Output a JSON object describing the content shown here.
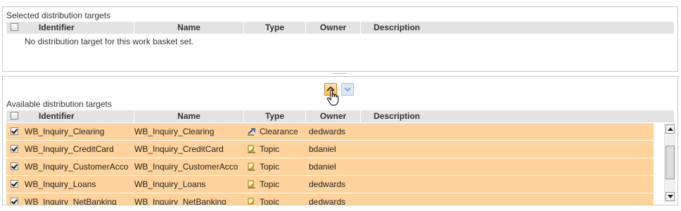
{
  "selected": {
    "title": "Selected distribution targets",
    "columns": {
      "identifier": "Identifier",
      "name": "Name",
      "type": "Type",
      "owner": "Owner",
      "description": "Description"
    },
    "empty_message": "No distribution target for this work basket set."
  },
  "available": {
    "title": "Available distribution targets",
    "columns": {
      "identifier": "Identifier",
      "name": "Name",
      "type": "Type",
      "owner": "Owner",
      "description": "Description"
    },
    "rows": [
      {
        "identifier": "WB_Inquiry_Clearing",
        "name": "WB_Inquiry_Clearing",
        "type": "Clearance",
        "type_icon": "clearance-arrow-icon",
        "owner": "dedwards",
        "description": "",
        "checked": true
      },
      {
        "identifier": "WB_Inquiry_CreditCard",
        "name": "WB_Inquiry_CreditCard",
        "type": "Topic",
        "type_icon": "topic-icon",
        "owner": "bdaniel",
        "description": "",
        "checked": true
      },
      {
        "identifier": "WB_Inquiry_CustomerAcco",
        "name": "WB_Inquiry_CustomerAcco",
        "type": "Topic",
        "type_icon": "topic-icon",
        "owner": "bdaniel",
        "description": "",
        "checked": true
      },
      {
        "identifier": "WB_Inquiry_Loans",
        "name": "WB_Inquiry_Loans",
        "type": "Topic",
        "type_icon": "topic-icon",
        "owner": "dedwards",
        "description": "",
        "checked": true
      },
      {
        "identifier": "WB_Inquiry_NetBanking",
        "name": "WB_Inquiry_NetBanking",
        "type": "Topic",
        "type_icon": "topic-icon",
        "owner": "dedwards",
        "description": "",
        "checked": true
      }
    ]
  },
  "controls": {
    "move_up_icon": "chevron-up-icon",
    "move_down_icon": "chevron-down-icon",
    "cursor": "hand-pointer-icon"
  },
  "colors": {
    "selected_row": "#ffd39b",
    "header_bg": "#e3e3e3",
    "move_up_bg": "#ffb94f",
    "move_down_bg": "#dde9f5"
  }
}
